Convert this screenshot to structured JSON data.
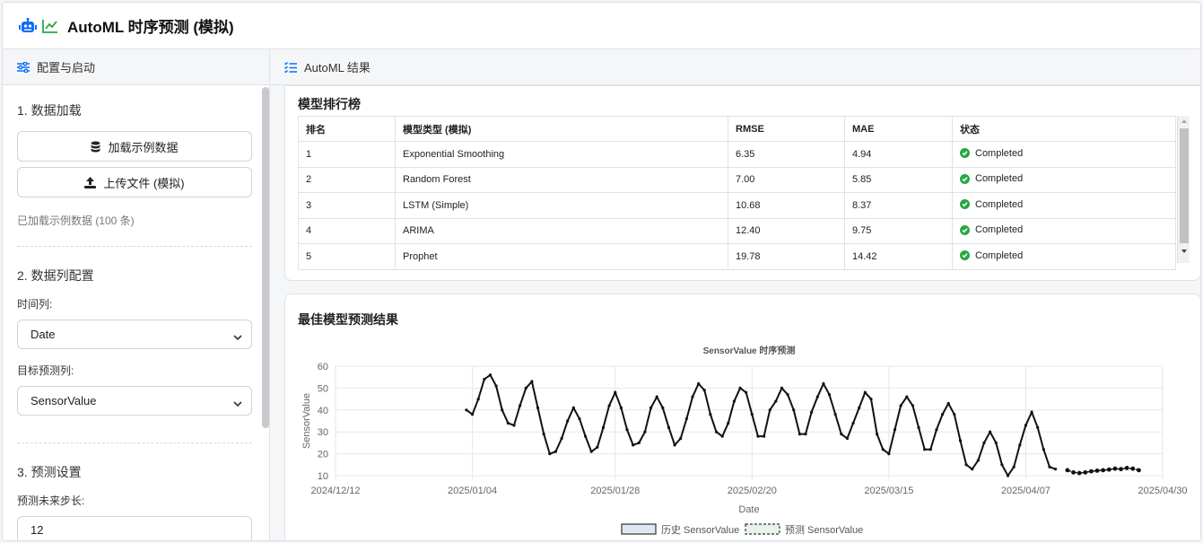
{
  "app": {
    "title": "AutoML 时序预测 (模拟)"
  },
  "left_panel": {
    "header": "配置与启动",
    "section1": {
      "title": "1. 数据加载",
      "load_sample": "加载示例数据",
      "upload": "上传文件 (模拟)",
      "status": "已加载示例数据 (100 条)"
    },
    "section2": {
      "title": "2. 数据列配置",
      "time_label": "时间列:",
      "time_value": "Date",
      "target_label": "目标预测列:",
      "target_value": "SensorValue"
    },
    "section3": {
      "title": "3. 预测设置",
      "horizon_label": "预测未来步长:",
      "horizon_value": "12"
    }
  },
  "right_panel": {
    "header": "AutoML 结果",
    "leaderboard": {
      "title": "模型排行榜",
      "columns": [
        "排名",
        "模型类型 (模拟)",
        "RMSE",
        "MAE",
        "状态"
      ],
      "rows": [
        [
          "1",
          "Exponential Smoothing",
          "6.35",
          "4.94",
          "Completed"
        ],
        [
          "2",
          "Random Forest",
          "7.00",
          "5.85",
          "Completed"
        ],
        [
          "3",
          "LSTM (Simple)",
          "10.68",
          "8.37",
          "Completed"
        ],
        [
          "4",
          "ARIMA",
          "12.40",
          "9.75",
          "Completed"
        ],
        [
          "5",
          "Prophet",
          "19.78",
          "14.42",
          "Completed"
        ]
      ]
    },
    "forecast": {
      "title": "最佳模型预测结果"
    }
  },
  "colors": {
    "accent": "#0d6efd",
    "success": "#28a745",
    "line": "#111111"
  },
  "chart_data": {
    "type": "line",
    "title": "SensorValue 时序预测",
    "xlabel": "Date",
    "ylabel": "SensorValue",
    "x_ticks": [
      "2024/12/12",
      "2025/01/04",
      "2025/01/28",
      "2025/02/20",
      "2025/03/15",
      "2025/04/07",
      "2025/04/30"
    ],
    "y_ticks": [
      10,
      20,
      30,
      40,
      50,
      60
    ],
    "ylim": [
      10,
      60
    ],
    "xlim": [
      "2024/12/12",
      "2025/04/30"
    ],
    "grid": true,
    "legend": {
      "placement": "bottom",
      "entries": [
        "历史 SensorValue",
        "预测 SensorValue"
      ]
    },
    "series": [
      {
        "name": "历史 SensorValue",
        "x_start": "2025/01/03",
        "step": "1 day",
        "values": [
          40,
          38,
          45,
          54,
          56,
          51,
          40,
          34,
          33,
          42,
          50,
          53,
          41,
          29,
          20,
          21,
          27,
          35,
          41,
          36,
          28,
          21,
          23,
          32,
          42,
          48,
          41,
          31,
          24,
          25,
          30,
          41,
          46,
          41,
          32,
          24,
          27,
          36,
          46,
          52,
          49,
          38,
          30,
          28,
          34,
          44,
          50,
          48,
          38,
          28,
          28,
          40,
          44,
          50,
          47,
          40,
          29,
          29,
          39,
          46,
          52,
          47,
          38,
          29,
          27,
          34,
          41,
          48,
          45,
          29,
          22,
          20,
          31,
          42,
          46,
          42,
          32,
          22,
          22,
          31,
          38,
          43,
          38,
          26,
          15,
          13,
          17,
          25,
          30,
          25,
          15,
          10,
          14,
          24,
          33,
          39,
          32,
          22,
          14,
          13
        ],
        "style": "solid"
      },
      {
        "name": "预测 SensorValue",
        "x_start": "2025/04/14",
        "step": "1 day",
        "values": [
          12.5,
          11.5,
          11.2,
          11.5,
          12,
          12.3,
          12.5,
          12.8,
          13.2,
          13,
          13.5,
          13.2,
          12.5
        ],
        "style": "dashed-points"
      }
    ]
  }
}
